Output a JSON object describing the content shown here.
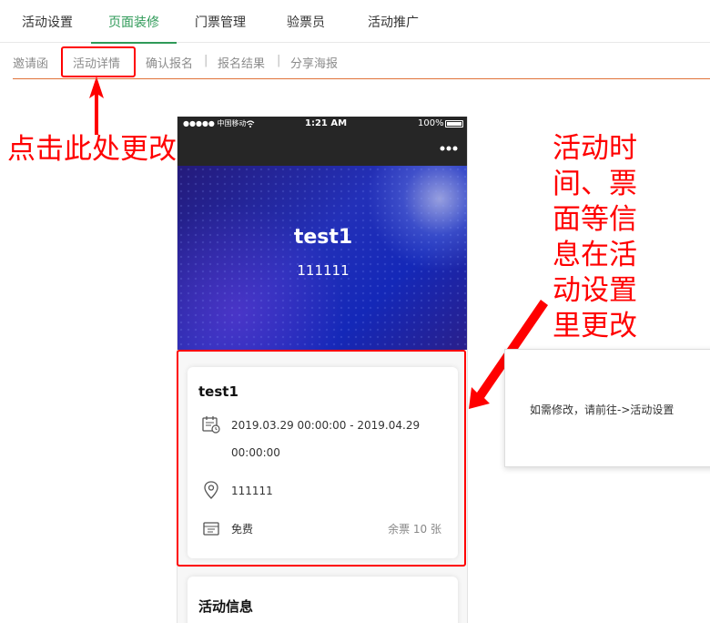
{
  "top_tabs": [
    {
      "label": "活动设置"
    },
    {
      "label": "页面装修",
      "active": true
    },
    {
      "label": "门票管理"
    },
    {
      "label": "验票员"
    },
    {
      "label": "活动推广"
    }
  ],
  "sub_tabs": [
    {
      "label": "邀请函"
    },
    {
      "label": "活动详情",
      "highlighted": true
    },
    {
      "label": "确认报名"
    },
    {
      "label": "报名结果"
    },
    {
      "label": "分享海报"
    }
  ],
  "sub_separator": "|",
  "annotations": {
    "detail_hint": "点击此处更改活动详情页面",
    "settings_hint_lines": [
      "活动时",
      "间、票",
      "面等信",
      "息在活",
      "动设置",
      "里更改"
    ],
    "color": "#ff0000"
  },
  "phone": {
    "status_bar": {
      "carrier": "●●●●● 中国移动",
      "time": "1:21 AM",
      "battery": "100%"
    },
    "menu_icon": "more-dots-icon",
    "hero": {
      "title": "test1",
      "subtitle": "111111"
    },
    "event_card": {
      "title": "test1",
      "time_line1": "2019.03.29 00:00:00 - 2019.04.29",
      "time_line2": "00:00:00",
      "location": "111111",
      "ticket_type": "免费",
      "remaining": "余票 10 张"
    },
    "info_card": {
      "title": "活动信息"
    }
  },
  "popup": {
    "text": "如需修改，请前往->活动设置"
  },
  "colors": {
    "accent_green": "#2f9a58",
    "divider_orange": "#e0733a",
    "annotation_red": "#ff0000",
    "phone_dark": "#262626"
  }
}
